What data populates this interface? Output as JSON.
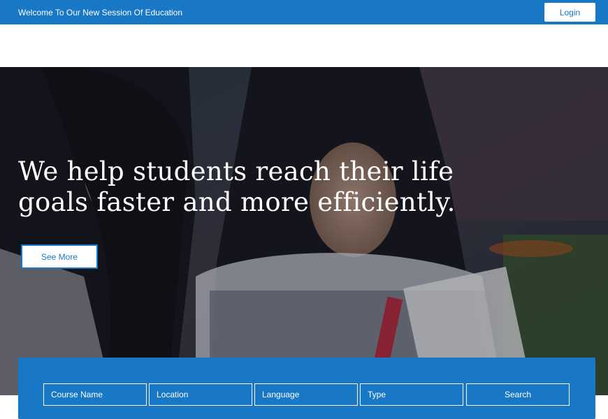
{
  "topbar": {
    "welcome_text": "Welcome To Our New Session Of Education",
    "login_label": "Login"
  },
  "hero": {
    "headline": "We help students reach their life goals faster and more efficiently.",
    "see_more_label": "See More"
  },
  "search": {
    "fields": [
      "Course Name",
      "Location",
      "Language",
      "Type"
    ],
    "button_label": "Search"
  },
  "colors": {
    "brand_blue": "#1878c6",
    "white": "#ffffff"
  }
}
